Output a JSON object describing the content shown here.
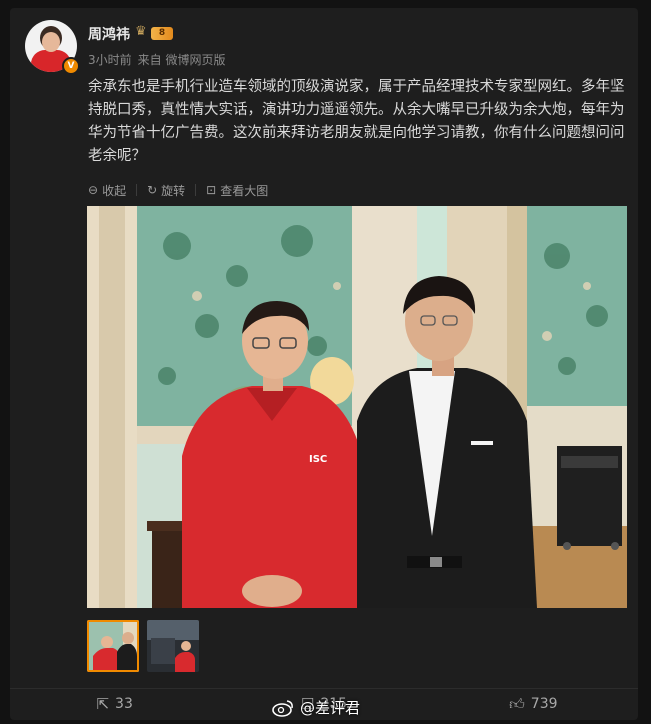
{
  "author": {
    "name": "周鸿祎",
    "vip_level": "8",
    "verified_icon": "verified-v-icon",
    "time": "3小时前",
    "source": "来自 微博网页版"
  },
  "post": {
    "text": "余承东也是手机行业造车领域的顶级演说家，属于产品经理技术专家型网红。多年坚持脱口秀，真性情大实话，演讲功力遥遥领先。从余大嘴早已升级为余大炮，每年为华为节省十亿广告费。这次前来拜访老朋友就是向他学习请教，你有什么问题想问问老余呢？",
    "shirt_logo": "ISC"
  },
  "toolbar": {
    "collapse_label": "收起",
    "rotate_label": "旋转",
    "view_large_label": "查看大图"
  },
  "actions": {
    "share_count": "33",
    "comment_count": "215",
    "like_count": "739"
  },
  "watermark": {
    "text": "@差评君"
  },
  "colors": {
    "accent": "#f08a00",
    "background": "#121212",
    "card": "#1e1e1e"
  }
}
